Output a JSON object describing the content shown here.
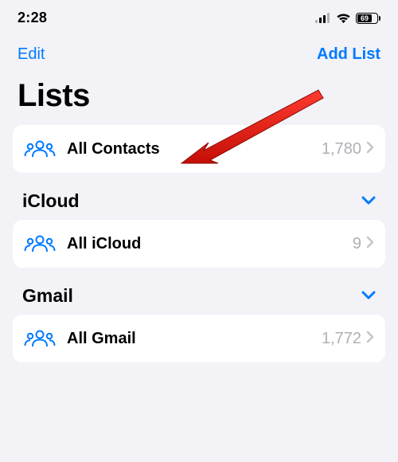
{
  "status": {
    "time": "2:28",
    "battery": "69"
  },
  "nav": {
    "edit": "Edit",
    "add_list": "Add List"
  },
  "title": "Lists",
  "rows": {
    "all_contacts": {
      "label": "All Contacts",
      "count": "1,780"
    },
    "all_icloud": {
      "label": "All iCloud",
      "count": "9"
    },
    "all_gmail": {
      "label": "All Gmail",
      "count": "1,772"
    }
  },
  "sections": {
    "icloud": "iCloud",
    "gmail": "Gmail"
  }
}
